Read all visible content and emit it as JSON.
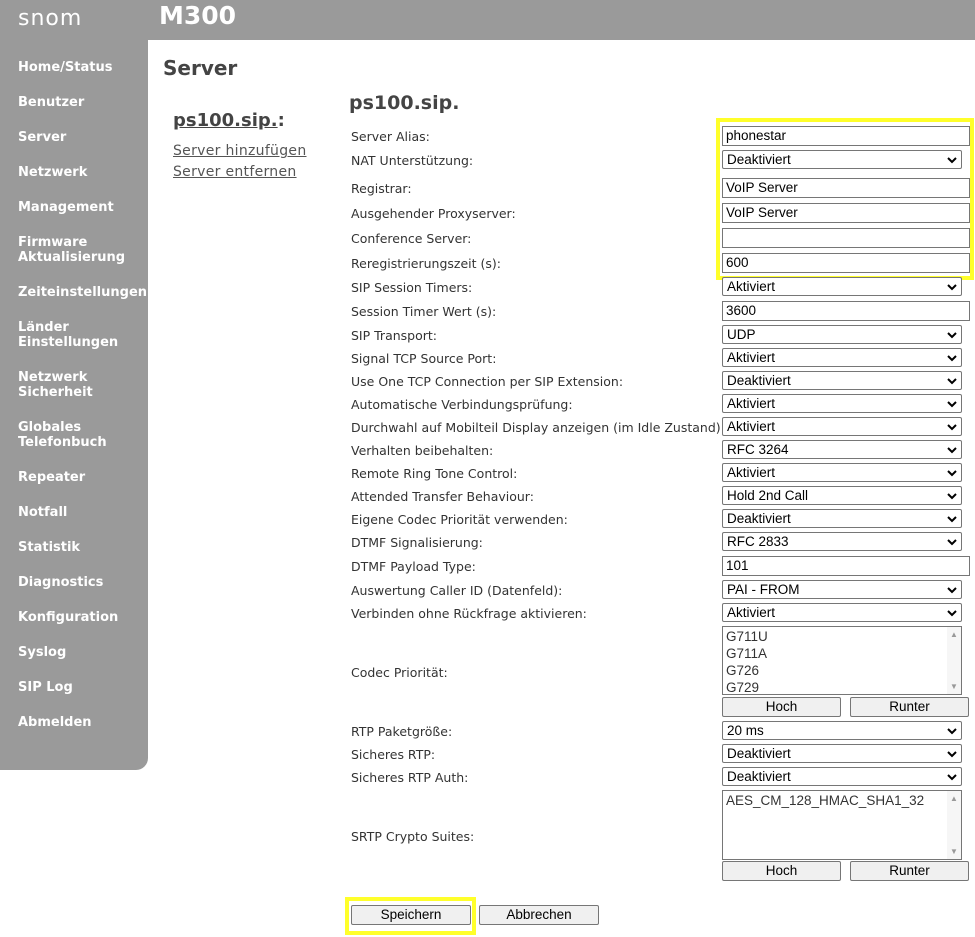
{
  "header": {
    "logo": "snom",
    "model": "M300"
  },
  "sidebar": {
    "items": [
      "Home/Status",
      "Benutzer",
      "Server",
      "Netzwerk",
      "Management",
      "Firmware Aktualisierung",
      "Zeiteinstellungen",
      "Länder Einstellungen",
      "Netzwerk Sicherheit",
      "Globales Telefonbuch",
      "Repeater",
      "Notfall",
      "Statistik",
      "Diagnostics",
      "Konfiguration",
      "Syslog",
      "SIP Log",
      "Abmelden"
    ]
  },
  "page": {
    "title": "Server"
  },
  "servers": {
    "current": "ps100.sip.",
    "add_link": "Server hinzufügen",
    "remove_link": "Server entfernen"
  },
  "form": {
    "title": "ps100.sip.",
    "fields": {
      "server_alias": {
        "label": "Server Alias:",
        "value": "phonestar"
      },
      "nat": {
        "label": "NAT Unterstützung:",
        "value": "Deaktiviert"
      },
      "registrar": {
        "label": "Registrar:",
        "value": "VoIP Server"
      },
      "outbound_proxy": {
        "label": "Ausgehender Proxyserver:",
        "value": "VoIP Server"
      },
      "conference_server": {
        "label": "Conference Server:",
        "value": ""
      },
      "reregistration": {
        "label": "Reregistrierungszeit (s):",
        "value": "600"
      },
      "session_timers": {
        "label": "SIP Session Timers:",
        "value": "Aktiviert"
      },
      "session_timer_value": {
        "label": "Session Timer Wert (s):",
        "value": "3600"
      },
      "sip_transport": {
        "label": "SIP Transport:",
        "value": "UDP"
      },
      "tcp_source_port": {
        "label": "Signal TCP Source Port:",
        "value": "Aktiviert"
      },
      "one_tcp_connection": {
        "label": "Use One TCP Connection per SIP Extension:",
        "value": "Deaktiviert"
      },
      "auto_check": {
        "label": "Automatische Verbindungsprüfung:",
        "value": "Aktiviert"
      },
      "ddi_display": {
        "label": "Durchwahl auf Mobilteil Display anzeigen (im Idle Zustand):",
        "value": "Aktiviert"
      },
      "behaviour": {
        "label": "Verhalten beibehalten:",
        "value": "RFC 3264"
      },
      "ring_tone_control": {
        "label": "Remote Ring Tone Control:",
        "value": "Aktiviert"
      },
      "attended_transfer": {
        "label": "Attended Transfer Behaviour:",
        "value": "Hold 2nd Call"
      },
      "own_codec_priority": {
        "label": "Eigene Codec Priorität verwenden:",
        "value": "Deaktiviert"
      },
      "dtmf": {
        "label": "DTMF Signalisierung:",
        "value": "RFC 2833"
      },
      "dtmf_payload": {
        "label": "DTMF Payload Type:",
        "value": "101"
      },
      "caller_id": {
        "label": "Auswertung Caller ID (Datenfeld):",
        "value": "PAI - FROM"
      },
      "connect_without_query": {
        "label": "Verbinden ohne Rückfrage aktivieren:",
        "value": "Aktiviert"
      },
      "codec_priority": {
        "label": "Codec Priorität:",
        "options": [
          "G711U",
          "G711A",
          "G726",
          "G729"
        ]
      },
      "rtp_packet_size": {
        "label": "RTP Paketgröße:",
        "value": "20 ms"
      },
      "secure_rtp": {
        "label": "Sicheres RTP:",
        "value": "Deaktiviert"
      },
      "secure_rtp_auth": {
        "label": "Sicheres RTP Auth:",
        "value": "Deaktiviert"
      },
      "srtp_suites": {
        "label": "SRTP Crypto Suites:",
        "options": [
          "AES_CM_128_HMAC_SHA1_32"
        ]
      }
    },
    "buttons": {
      "up": "Hoch",
      "down": "Runter",
      "save": "Speichern",
      "cancel": "Abbrechen"
    }
  },
  "colors": {
    "sidebar": "#9a9a9a",
    "highlight": "#ffff2a"
  }
}
